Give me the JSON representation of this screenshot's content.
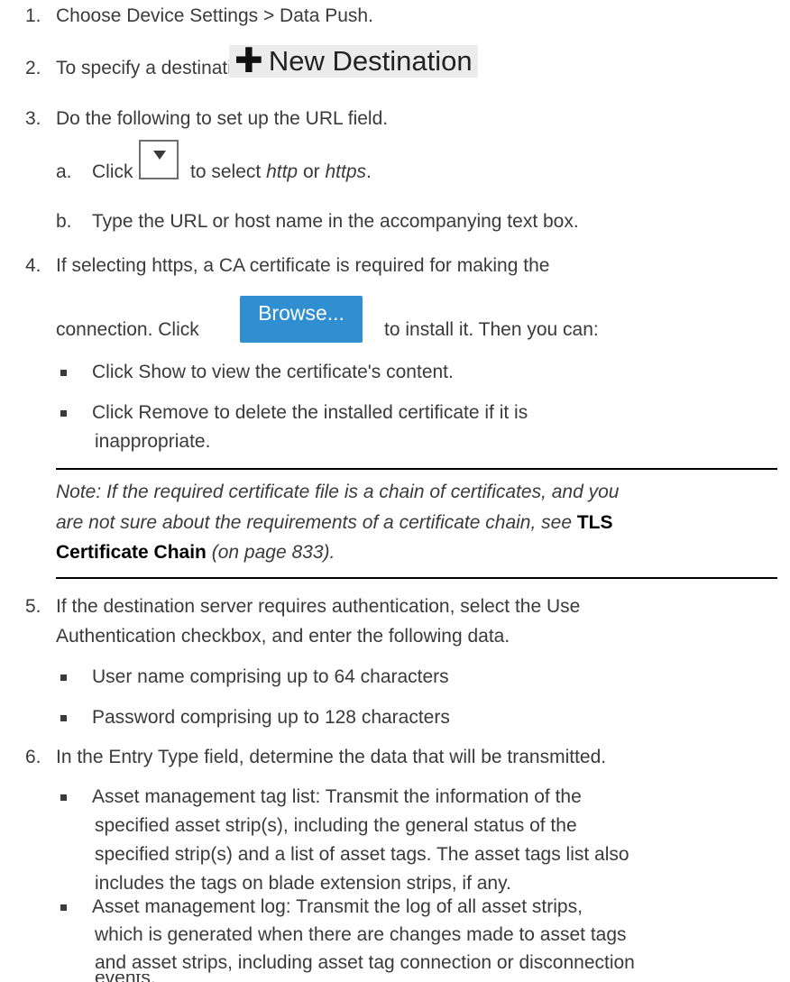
{
  "steps": {
    "s1": {
      "num": "1.",
      "text": "Choose Device Settings > Data Push."
    },
    "s2": {
      "num": "2.",
      "before": "To specify a destination, click",
      "after": "."
    },
    "new_destination_label": "New Destination",
    "s3": {
      "num": "3.",
      "text": "Do the following to set up the URL field."
    },
    "s3a": {
      "num": "a.",
      "before": "Click",
      "mid": "to select",
      "opt1": "http",
      "or": "or",
      "opt2": "https",
      "end": "."
    },
    "s3b": {
      "num": "b.",
      "text": "Type the URL or host name in the accompanying text box."
    },
    "s4": {
      "num": "4.",
      "line1": "If selecting https, a CA certificate is required for making the",
      "line2_before": "connection. Click",
      "line2_after": "to install it. Then you can:"
    },
    "browse_label": "Browse...",
    "s4_b1": "Click Show to view the certificate's content.",
    "s4_b2_l1": "Click Remove to delete the installed certificate if it is",
    "s4_b2_l2": "inappropriate.",
    "note": {
      "l1": "Note: If the required certificate file is a chain of certificates, and you",
      "l2_italic": "are not sure about the requirements of a certificate chain, see",
      "link_a": "TLS",
      "link_b": "Certificate Chain",
      "ref": "(on page 833)."
    },
    "s5": {
      "num": "5.",
      "l1": "If the destination server requires authentication, select the Use",
      "l2": "Authentication checkbox, and enter the following data."
    },
    "s5_b1": "User name comprising up to 64 characters",
    "s5_b2": "Password comprising up to 128 characters",
    "s6": {
      "num": "6.",
      "text": "In the Entry Type field, determine the data that will be transmitted."
    },
    "s6_b1": [
      "Asset management tag list: Transmit the information of the",
      "specified asset strip(s), including the general status of the",
      "specified strip(s) and a list of asset tags. The asset tags list also",
      "includes the tags on blade extension strips, if any."
    ],
    "s6_b2": [
      "Asset management log: Transmit the log of all asset strips,",
      "which is generated when there are changes made to asset tags",
      "and asset strips, including asset tag connection or disconnection",
      "events."
    ]
  },
  "colors": {
    "text": "#3a3a3a",
    "browse_button": "#2f8fd0",
    "new_destination_bg": "#ececec"
  },
  "icons": {
    "plus": "plus-icon",
    "dropdown": "dropdown-arrow-icon"
  }
}
